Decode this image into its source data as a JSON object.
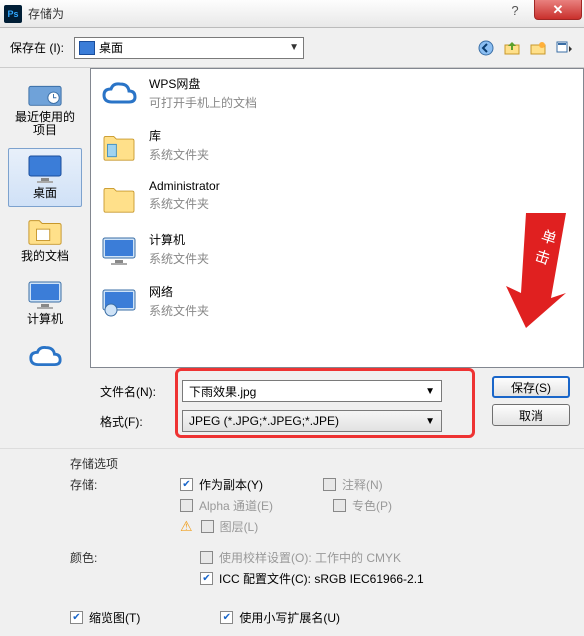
{
  "title": "存储为",
  "saveIn": {
    "label": "保存在 (I):",
    "value": "桌面"
  },
  "places": [
    {
      "id": "recent",
      "label": "最近使用的项目"
    },
    {
      "id": "desktop",
      "label": "桌面",
      "selected": true
    },
    {
      "id": "mydocs",
      "label": "我的文档"
    },
    {
      "id": "computer",
      "label": "计算机"
    },
    {
      "id": "wps",
      "label": "WPS网盘"
    }
  ],
  "files": [
    {
      "name": "WPS网盘",
      "sub": "可打开手机上的文档",
      "icon": "cloud"
    },
    {
      "name": "库",
      "sub": "系统文件夹",
      "icon": "folder-lib"
    },
    {
      "name": "Administrator",
      "sub": "系统文件夹",
      "icon": "folder"
    },
    {
      "name": "计算机",
      "sub": "系统文件夹",
      "icon": "monitor"
    },
    {
      "name": "网络",
      "sub": "系统文件夹",
      "icon": "monitor-net"
    }
  ],
  "filename": {
    "label": "文件名(N):",
    "value": "下雨效果.jpg"
  },
  "format": {
    "label": "格式(F):",
    "value": "JPEG (*.JPG;*.JPEG;*.JPE)"
  },
  "buttons": {
    "save": "保存(S)",
    "cancel": "取消"
  },
  "options": {
    "group_title": "存储选项",
    "store_label": "存储:",
    "as_copy": "作为副本(Y)",
    "annotations": "注释(N)",
    "alpha": "Alpha 通道(E)",
    "spot": "专色(P)",
    "layers": "图层(L)",
    "color_label": "颜色:",
    "proof": {
      "text": "使用校样设置(O): ",
      "suffix": "工作中的 CMYK"
    },
    "icc": {
      "prefix": "ICC 配置文件(C): ",
      "value": "sRGB IEC61966-2.1"
    },
    "thumbnail": "缩览图(T)",
    "lowercase_ext": "使用小写扩展名(U)"
  },
  "callout": "单击"
}
